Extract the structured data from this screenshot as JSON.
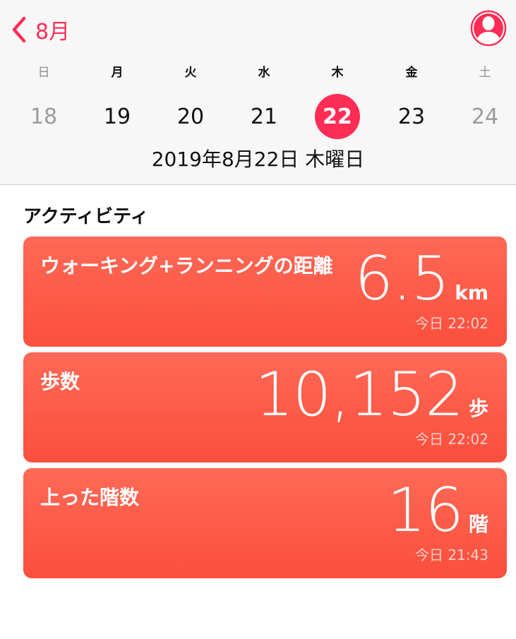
{
  "header": {
    "back_label": "8月",
    "weekdays": [
      "日",
      "月",
      "火",
      "水",
      "木",
      "金",
      "土"
    ],
    "dates": [
      "18",
      "19",
      "20",
      "21",
      "22",
      "23",
      "24"
    ],
    "selected_date": "22",
    "full_date": "2019年8月22日 木曜日"
  },
  "section": {
    "title": "アクティビティ"
  },
  "cards": [
    {
      "title": "ウォーキング+ランニングの距離",
      "value": "6.5",
      "unit": "km",
      "time": "今日 22:02"
    },
    {
      "title": "歩数",
      "value": "10,152",
      "unit": "歩",
      "time": "今日 22:02"
    },
    {
      "title": "上った階数",
      "value": "16",
      "unit": "階",
      "time": "今日 21:43"
    }
  ],
  "colors": {
    "accent": "#ff2d55",
    "card_top": "#fe6957",
    "card_bottom": "#fb4f3c",
    "header_bg": "#f7f7f7"
  },
  "icons": {
    "back": "chevron-left-icon",
    "profile": "profile-icon"
  }
}
